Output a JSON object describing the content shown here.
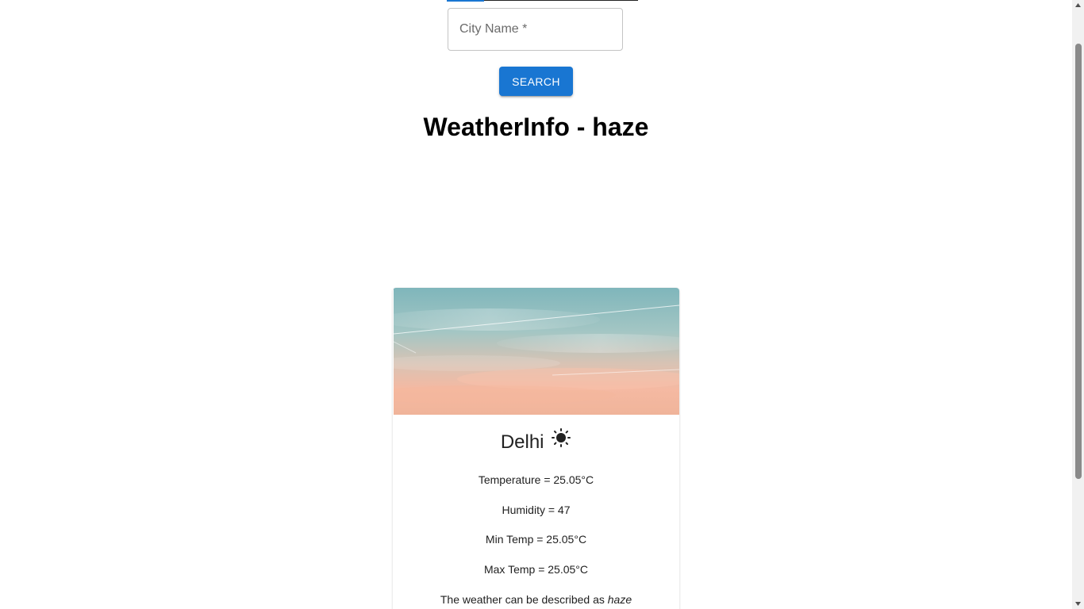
{
  "search": {
    "placeholder": "City Name *",
    "button_label": "SEARCH"
  },
  "header": {
    "title": "WeatherInfo - haze"
  },
  "card": {
    "image_name": "hazy-sky-image",
    "city": "Delhi",
    "condition_icon": "sun-icon",
    "temperature": "Temperature = 25.05°C",
    "humidity": "Humidity = 47",
    "min_temp": "Min Temp = 25.05°C",
    "max_temp": "Max Temp = 25.05°C",
    "description_prefix": "The weather can be described as",
    "description_value": "haze"
  },
  "colors": {
    "primary": "#1976d2",
    "title": "#000000",
    "text": "#212121"
  }
}
